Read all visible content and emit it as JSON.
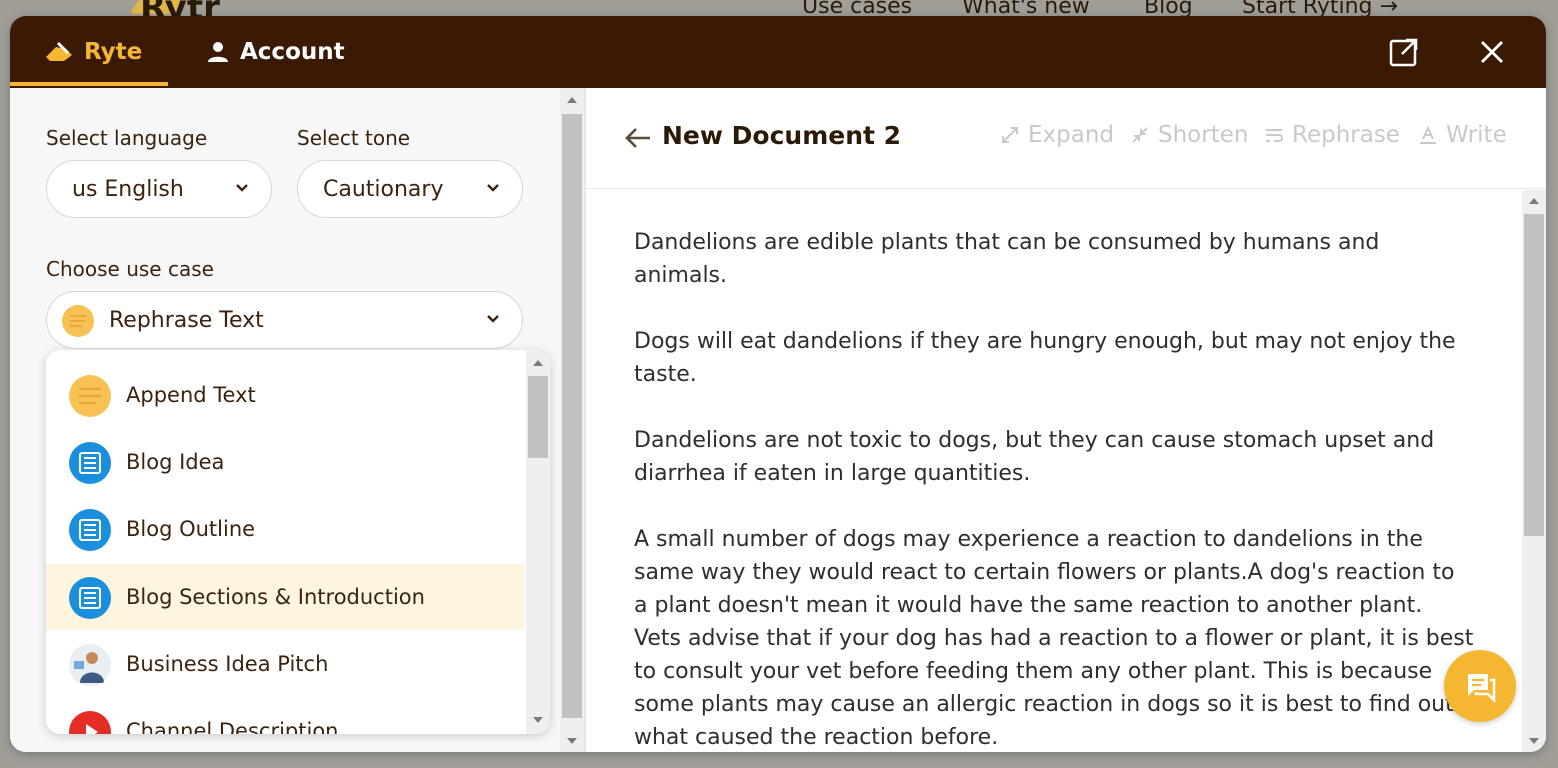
{
  "background_site": {
    "logo_text": "Rytr",
    "nav": [
      "Use cases",
      "What's new",
      "Blog",
      "Start Ryting →"
    ]
  },
  "header": {
    "tabs": [
      {
        "label": "Ryte",
        "icon": "writing-hand-icon",
        "active": true
      },
      {
        "label": "Account",
        "icon": "user-icon",
        "active": false
      }
    ],
    "actions": [
      "open-external-icon",
      "close-icon"
    ],
    "accent_color": "#f5b731",
    "background_color": "#3a1a05"
  },
  "left_panel": {
    "language_label": "Select language",
    "language_value": "us English",
    "tone_label": "Select tone",
    "tone_value": "Cautionary",
    "use_case_label": "Choose use case",
    "use_case_value": "Rephrase Text",
    "use_case_options": [
      {
        "label": "Append Text",
        "icon": "notes-icon"
      },
      {
        "label": "Blog Idea",
        "icon": "list-icon"
      },
      {
        "label": "Blog Outline",
        "icon": "list-icon"
      },
      {
        "label": "Blog Sections & Introduction",
        "icon": "list-icon",
        "highlighted": true
      },
      {
        "label": "Business Idea Pitch",
        "icon": "person-icon"
      },
      {
        "label": "Channel Description",
        "icon": "youtube-icon"
      }
    ]
  },
  "document": {
    "title": "New Document 2",
    "tools": [
      "Expand",
      "Shorten",
      "Rephrase",
      "Write"
    ],
    "paragraphs": [
      "Dandelions are edible plants that can be consumed by humans and animals.",
      "Dogs will eat dandelions if they are hungry enough, but may not enjoy the taste.",
      "Dandelions are not toxic to dogs, but they can cause stomach upset and diarrhea if eaten in large quantities.",
      "A small number of dogs may experience a reaction to dandelions in the same way they would react to certain flowers or plants.A dog's reaction to a plant doesn't mean it would have the same reaction to another plant. Vets advise that if your dog has had a reaction to a flower or plant, it is best to consult your vet before feeding them any other plant. This is because some plants may cause an allergic reaction in dogs so it is best to find out what caused the reaction before."
    ]
  }
}
